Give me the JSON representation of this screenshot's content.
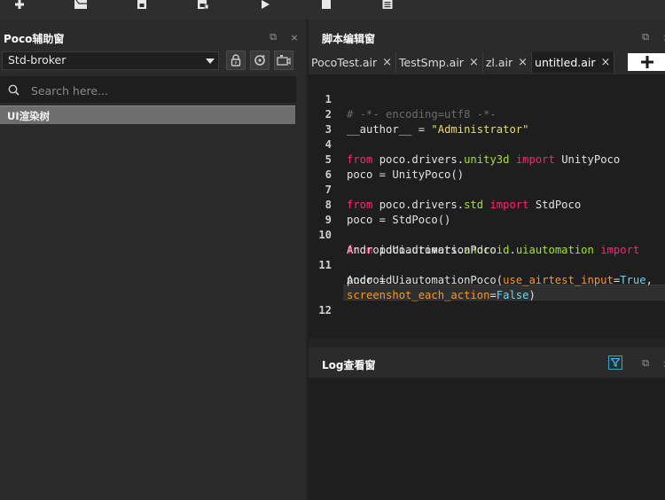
{
  "toolbar": {
    "buttons": [
      {
        "icon": "new-file-icon"
      },
      {
        "icon": "open-folder-icon"
      },
      {
        "icon": "save-icon"
      },
      {
        "icon": "save-as-icon"
      },
      {
        "icon": "play-icon"
      },
      {
        "icon": "stop-icon"
      },
      {
        "icon": "report-icon"
      }
    ]
  },
  "poco_panel": {
    "title": "Poco辅助窗",
    "device_select": {
      "value": "Std-broker"
    },
    "search": {
      "placeholder": "Search here..."
    },
    "tree_header": "UI渲染树"
  },
  "editor_panel": {
    "title": "脚本编辑窗",
    "tabs": [
      {
        "label": "PocoTest.air",
        "close": "×"
      },
      {
        "label": "TestSmp.air",
        "close": "×"
      },
      {
        "label": "zl.air",
        "close": "×"
      },
      {
        "label": "untitled.air",
        "close": "×",
        "active": true
      }
    ],
    "add_tab": "+",
    "code": {
      "line_numbers": [
        "1",
        "2",
        "3",
        "4",
        "5",
        "6",
        "7",
        "8",
        "9",
        "10",
        "11",
        "12"
      ],
      "l1": "# -*- encoding=utf8 -*-",
      "l2_a": "__author__ = ",
      "l2_b": "\"Administrator\"",
      "kw_from": "from",
      "kw_import": "import",
      "l4_mod": "poco.drivers.unity3d",
      "l4_cls": "UnityPoco",
      "l5": "poco = UnityPoco()",
      "l7_mod": "poco.drivers.std",
      "l7_cls": "StdPoco",
      "l8": "poco = StdPoco()",
      "l10_mod": "poco.drivers.android.uiautomation",
      "l10_cont": "AndroidUiautomationPoco",
      "l11_a": "poco =",
      "l11_b": "AndroidUiautomationPoco(",
      "l11_param1": "use_airtest_input",
      "l11_eq": "=",
      "l11_true": "True",
      "l11_comma": ",",
      "l11_param2": "screenshot_each_action",
      "l11_false": "False",
      "l11_close": ")"
    }
  },
  "log_panel": {
    "title": "Log查看窗"
  },
  "window_icons": {
    "restore": "⧉",
    "close": "×"
  },
  "colors": {
    "keyword": "#f92672",
    "module": "#a6e22e",
    "string": "#e6db74",
    "param": "#fd971f",
    "boolean": "#66d9ef",
    "comment": "#6b6b6b"
  }
}
